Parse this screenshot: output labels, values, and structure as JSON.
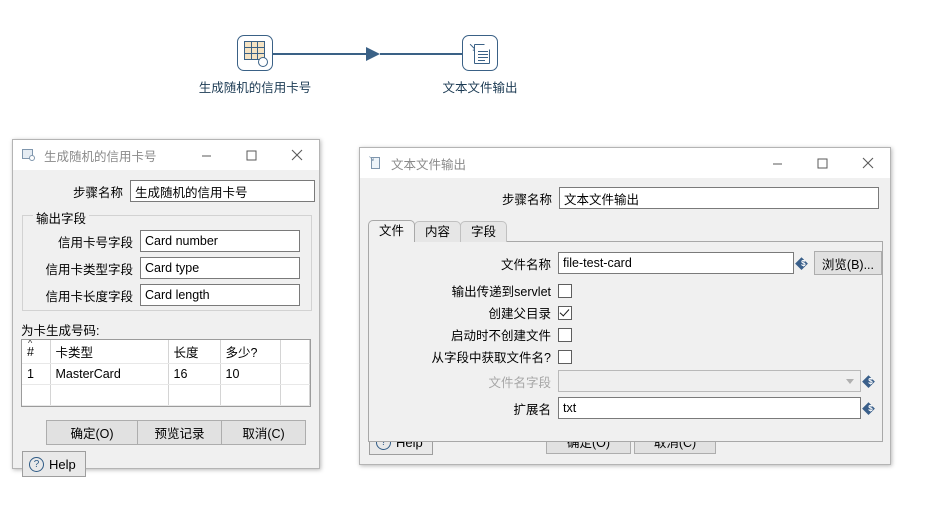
{
  "flow": {
    "nodes": [
      {
        "icon": "generate-random-credit-card-icon",
        "label": "生成随机的信用卡号"
      },
      {
        "icon": "text-file-output-icon",
        "label": "文本文件输出"
      }
    ],
    "hop": {
      "name": "hop-connector"
    }
  },
  "colors": {
    "node_outline": "#3a6186",
    "hop": "#3a6186",
    "icon_fill": "#f5e3c3",
    "variable_diamond": "#3a5f8a",
    "dialog_bg": "#f0f0f0"
  },
  "left_dialog": {
    "title": "生成随机的信用卡号",
    "title_icon": "generate-random-credit-card-icon",
    "window_buttons": {
      "minimize": "—",
      "maximize": "▢",
      "close": "✕"
    },
    "step_name_label": "步骤名称",
    "step_name_value": "生成随机的信用卡号",
    "group_title": "输出字段",
    "fields": [
      {
        "label": "信用卡号字段",
        "value": "Card number"
      },
      {
        "label": "信用卡类型字段",
        "value": "Card type"
      },
      {
        "label": "信用卡长度字段",
        "value": "Card length"
      }
    ],
    "table_caption": "为卡生成号码:",
    "table": {
      "headers": [
        "#",
        "卡类型",
        "长度",
        "多少?",
        ""
      ],
      "sorted_column": "#",
      "sort_direction": "^",
      "rows": [
        [
          "1",
          "MasterCard",
          "16",
          "10",
          ""
        ],
        [
          "",
          "",
          "",
          "",
          ""
        ]
      ]
    },
    "buttons": {
      "ok": "确定(O)",
      "preview": "预览记录",
      "cancel": "取消(C)",
      "help": "Help"
    }
  },
  "right_dialog": {
    "title": "文本文件输出",
    "title_icon": "text-file-output-icon",
    "window_buttons": {
      "minimize": "—",
      "maximize": "▢",
      "close": "✕"
    },
    "step_name_label": "步骤名称",
    "step_name_value": "文本文件输出",
    "tabs": [
      {
        "label": "文件",
        "active": true
      },
      {
        "label": "内容",
        "active": false
      },
      {
        "label": "字段",
        "active": false
      }
    ],
    "file_tab": {
      "filename_label": "文件名称",
      "filename_value": "file-test-card",
      "browse_button": "浏览(B)...",
      "checkboxes": [
        {
          "label": "输出传递到servlet",
          "checked": false
        },
        {
          "label": "创建父目录",
          "checked": true
        },
        {
          "label": "启动时不创建文件",
          "checked": false
        },
        {
          "label": "从字段中获取文件名?",
          "checked": false
        }
      ],
      "filename_field_label": "文件名字段",
      "filename_field_value": "",
      "filename_field_disabled": true,
      "extension_label": "扩展名",
      "extension_value": "txt"
    },
    "buttons": {
      "ok": "确定(O)",
      "cancel": "取消(C)",
      "help": "Help"
    }
  }
}
